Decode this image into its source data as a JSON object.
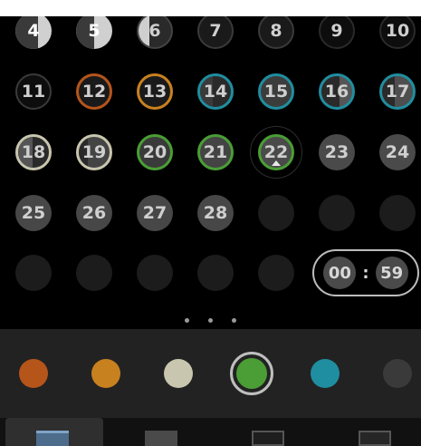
{
  "calendar": {
    "row1": [
      {
        "label": "4"
      },
      {
        "label": "5"
      },
      {
        "label": "6"
      },
      {
        "label": "7"
      },
      {
        "label": "8"
      },
      {
        "label": "9"
      },
      {
        "label": "10"
      }
    ],
    "row2": [
      {
        "label": "11"
      },
      {
        "label": "12"
      },
      {
        "label": "13"
      },
      {
        "label": "14"
      },
      {
        "label": "15"
      },
      {
        "label": "16"
      },
      {
        "label": "17"
      }
    ],
    "row3": [
      {
        "label": "18"
      },
      {
        "label": "19"
      },
      {
        "label": "20"
      },
      {
        "label": "21"
      },
      {
        "label": "22"
      },
      {
        "label": "23"
      },
      {
        "label": "24"
      }
    ],
    "row4": [
      {
        "label": "25"
      },
      {
        "label": "26"
      },
      {
        "label": "27"
      },
      {
        "label": "28"
      }
    ],
    "selected_day": "22"
  },
  "timer": {
    "minutes": "00",
    "separator": ":",
    "seconds": "59"
  },
  "colors": {
    "orange": "#b5551a",
    "amber": "#c8811f",
    "beige": "#c8c6ae",
    "green": "#4a9e35",
    "teal": "#1f8ea0",
    "gray": "#3a3a3a"
  },
  "palette": {
    "swatches": [
      "#b5551a",
      "#c8811f",
      "#c8c6ae",
      "#4a9e35",
      "#1f8ea0",
      "#3a3a3a"
    ],
    "selected_index": 3
  },
  "tabs": {
    "items": [
      {
        "icon": "calendar-icon",
        "active": true
      },
      {
        "icon": "graph-icon",
        "active": false
      },
      {
        "icon": "image-icon",
        "active": false
      },
      {
        "icon": "list-icon",
        "active": false
      }
    ]
  }
}
